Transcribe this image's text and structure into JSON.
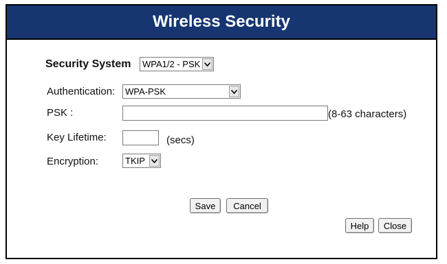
{
  "header": {
    "title": "Wireless Security"
  },
  "security_system": {
    "label": "Security System",
    "selected": "WPA1/2 - PSK"
  },
  "form": {
    "authentication": {
      "label": "Authentication:",
      "selected": "WPA-PSK"
    },
    "psk": {
      "label": "PSK :",
      "value": "",
      "hint": "(8-63 characters)"
    },
    "key_lifetime": {
      "label": "Key Lifetime:",
      "value": "",
      "unit": "(secs)"
    },
    "encryption": {
      "label": "Encryption:",
      "selected": "TKIP"
    }
  },
  "buttons": {
    "save": "Save",
    "cancel": "Cancel",
    "help": "Help",
    "close": "Close"
  },
  "colors": {
    "title_bar": "#163571",
    "title_text": "#ffffff"
  },
  "icons": {
    "dropdown": "chevron-down-icon"
  }
}
